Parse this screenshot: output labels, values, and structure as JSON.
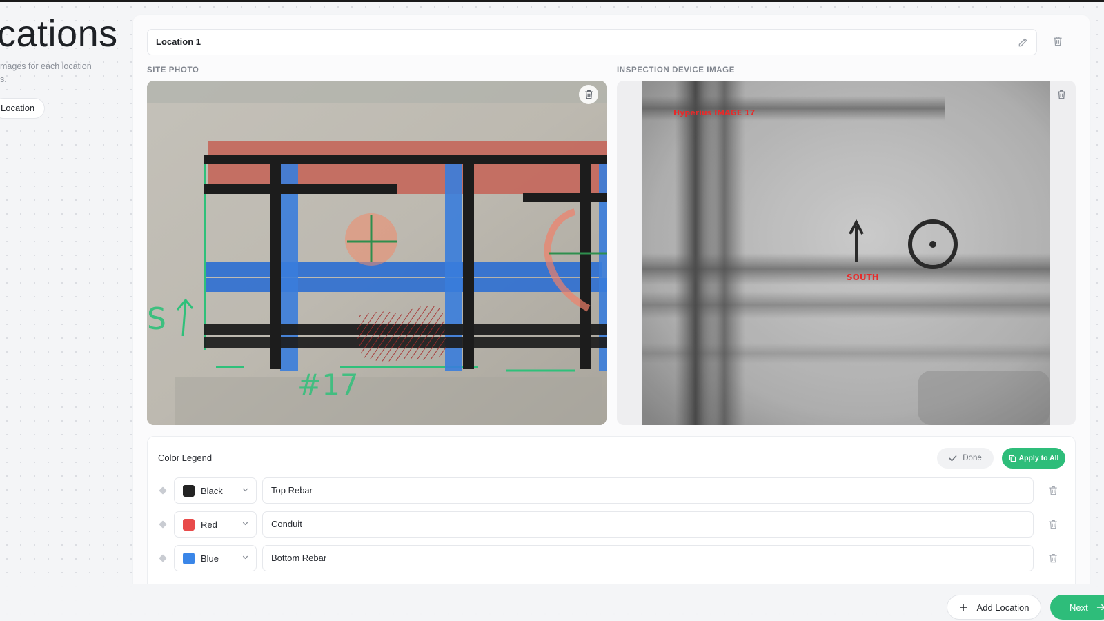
{
  "sidebar": {
    "title_partial": "cations",
    "subtitle_line1": "mages for each location",
    "subtitle_line2": "s.",
    "location_chip": "Location"
  },
  "location": {
    "name": "Location 1"
  },
  "photos": {
    "site_label": "SITE PHOTO",
    "inspection_label": "INSPECTION DEVICE IMAGE",
    "inspection_overlay_text": "Hyperius IMAGE 17",
    "inspection_direction_text": "SOUTH",
    "site_annotation_text": "#17"
  },
  "legend": {
    "title": "Color Legend",
    "done_label": "Done",
    "apply_label": "Apply to All",
    "rows": [
      {
        "color_name": "Black",
        "color_hex": "#232323",
        "description": "Top Rebar"
      },
      {
        "color_name": "Red",
        "color_hex": "#e84a4a",
        "description": "Conduit"
      },
      {
        "color_name": "Blue",
        "color_hex": "#3a86e8",
        "description": "Bottom Rebar"
      }
    ]
  },
  "footer": {
    "add_location_label": "Add Location",
    "next_label": "Next"
  },
  "colors": {
    "accent_green": "#2ebd7a"
  }
}
